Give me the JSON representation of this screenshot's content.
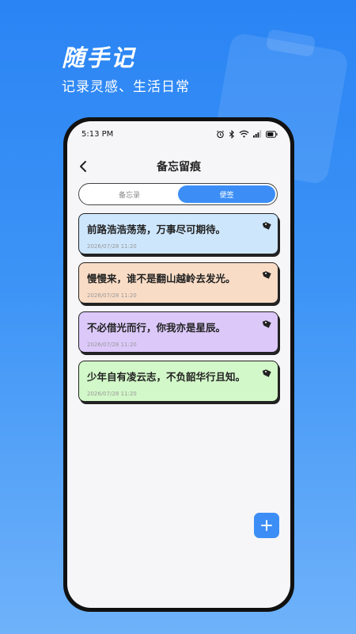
{
  "hero": {
    "title": "随手记",
    "subtitle": "记录灵感、生活日常"
  },
  "status_bar": {
    "time": "5:13 PM",
    "icons": [
      "alarm-icon",
      "bluetooth-icon",
      "wifi-icon",
      "signal-icon",
      "battery-icon"
    ]
  },
  "nav": {
    "back_icon": "chevron-left-icon",
    "title": "备忘留痕"
  },
  "tabs": [
    {
      "label": "备忘录",
      "active": false
    },
    {
      "label": "便签",
      "active": true
    }
  ],
  "notes": [
    {
      "text": "前路浩浩荡荡，万事尽可期待。",
      "date": "2026/07/28 11:20",
      "color": "#cde6fc",
      "icon": "tag-icon"
    },
    {
      "text": "慢慢来，谁不是翻山越岭去发光。",
      "date": "2026/07/28 11:20",
      "color": "#f9dcc6",
      "icon": "tag-icon"
    },
    {
      "text": "不必借光而行，你我亦是星辰。",
      "date": "2026/07/28 11:20",
      "color": "#dcc9fa",
      "icon": "tag-icon"
    },
    {
      "text": "少年自有凌云志，不负韶华行且知。",
      "date": "2026/07/28 11:20",
      "color": "#d2f7c8",
      "icon": "tag-icon"
    }
  ],
  "fab": {
    "icon": "plus-icon"
  },
  "colors": {
    "accent": "#3c8ef6",
    "background": "#2a84f4"
  }
}
